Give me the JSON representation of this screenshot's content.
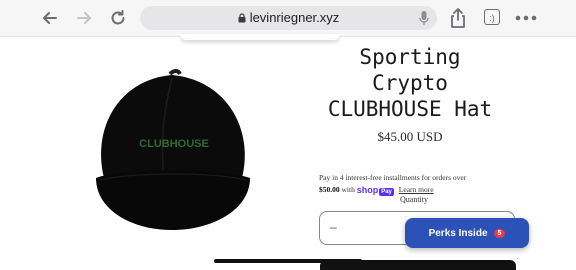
{
  "browser": {
    "url": "levinriegner.xyz",
    "tab_count": ":)"
  },
  "product": {
    "title_lines": [
      "Sporting",
      "Crypto",
      "CLUBHOUSE Hat"
    ],
    "image_text": "CLUBHOUSE",
    "price": "$45.00 USD",
    "installments_text": "Pay in 4 interest-free installments for orders over",
    "installments_threshold": "$50.00",
    "installments_with": "with",
    "shop_pay_label": "shop",
    "pay_badge": "Pay",
    "learn_more": "Learn more",
    "quantity_label": "Quantity",
    "quantity_value": "–"
  },
  "perks": {
    "label": "Perks Inside",
    "count": "5"
  },
  "colors": {
    "shop_pay": "#5a31f4",
    "perks_button": "#2c52b8",
    "perks_badge": "#e23b4b",
    "hat": "#0b0b0b",
    "hat_text": "#2f6b34"
  }
}
